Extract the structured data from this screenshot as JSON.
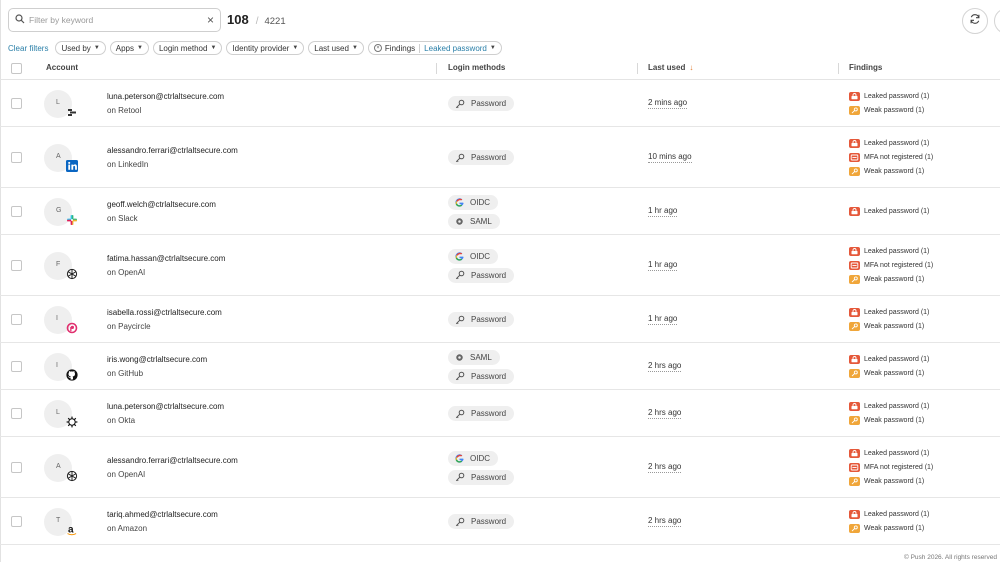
{
  "search": {
    "placeholder": "Filter by keyword",
    "value": ""
  },
  "count": {
    "shown": "108",
    "separator": "/",
    "total": "4221"
  },
  "filters": {
    "clear_label": "Clear filters",
    "chips": [
      {
        "label": "Used by",
        "value": ""
      },
      {
        "label": "Apps",
        "value": ""
      },
      {
        "label": "Login method",
        "value": ""
      },
      {
        "label": "Identity provider",
        "value": ""
      },
      {
        "label": "Last used",
        "value": ""
      },
      {
        "label": "Findings",
        "value": "Leaked password"
      }
    ]
  },
  "columns": {
    "account": "Account",
    "login_methods": "Login methods",
    "last_used": "Last used",
    "findings": "Findings"
  },
  "sort": {
    "column": "Last used",
    "direction": "desc",
    "arrow": "↓"
  },
  "colors": {
    "accent": "#2a7fa8",
    "leaked": "#e5583a",
    "weak": "#f0a63a",
    "sort_arrow": "#e07a2e"
  },
  "rows": [
    {
      "initial": "L",
      "app_icon": "retool-icon",
      "email": "luna.peterson@ctrlaltsecure.com",
      "app": "on Retool",
      "methods": [
        {
          "icon": "key-icon",
          "label": "Password"
        }
      ],
      "last_used": "2 mins ago",
      "findings": [
        {
          "type": "leaked",
          "label": "Leaked password (1)"
        },
        {
          "type": "weak",
          "label": "Weak password (1)"
        }
      ]
    },
    {
      "initial": "A",
      "app_icon": "linkedin-icon",
      "email": "alessandro.ferrari@ctrlaltsecure.com",
      "app": "on LinkedIn",
      "methods": [
        {
          "icon": "key-icon",
          "label": "Password"
        }
      ],
      "last_used": "10 mins ago",
      "findings": [
        {
          "type": "leaked",
          "label": "Leaked password (1)"
        },
        {
          "type": "mfa",
          "label": "MFA not registered (1)"
        },
        {
          "type": "weak",
          "label": "Weak password (1)"
        }
      ]
    },
    {
      "initial": "G",
      "app_icon": "slack-icon",
      "email": "geoff.welch@ctrlaltsecure.com",
      "app": "on Slack",
      "methods": [
        {
          "icon": "google-icon",
          "label": "OIDC"
        },
        {
          "icon": "saml-icon",
          "label": "SAML"
        }
      ],
      "last_used": "1 hr ago",
      "findings": [
        {
          "type": "leaked",
          "label": "Leaked password (1)"
        }
      ]
    },
    {
      "initial": "F",
      "app_icon": "openai-icon",
      "email": "fatima.hassan@ctrlaltsecure.com",
      "app": "on OpenAI",
      "methods": [
        {
          "icon": "google-icon",
          "label": "OIDC"
        },
        {
          "icon": "key-icon",
          "label": "Password"
        }
      ],
      "last_used": "1 hr ago",
      "findings": [
        {
          "type": "leaked",
          "label": "Leaked password (1)"
        },
        {
          "type": "mfa",
          "label": "MFA not registered (1)"
        },
        {
          "type": "weak",
          "label": "Weak password (1)"
        }
      ]
    },
    {
      "initial": "I",
      "app_icon": "paycircle-icon",
      "email": "isabella.rossi@ctrlaltsecure.com",
      "app": "on Paycircle",
      "methods": [
        {
          "icon": "key-icon",
          "label": "Password"
        }
      ],
      "last_used": "1 hr ago",
      "findings": [
        {
          "type": "leaked",
          "label": "Leaked password (1)"
        },
        {
          "type": "weak",
          "label": "Weak password (1)"
        }
      ]
    },
    {
      "initial": "I",
      "app_icon": "github-icon",
      "email": "iris.wong@ctrlaltsecure.com",
      "app": "on GitHub",
      "methods": [
        {
          "icon": "saml-icon",
          "label": "SAML"
        },
        {
          "icon": "key-icon",
          "label": "Password"
        }
      ],
      "last_used": "2 hrs ago",
      "findings": [
        {
          "type": "leaked",
          "label": "Leaked password (1)"
        },
        {
          "type": "weak",
          "label": "Weak password (1)"
        }
      ]
    },
    {
      "initial": "L",
      "app_icon": "okta-icon",
      "email": "luna.peterson@ctrlaltsecure.com",
      "app": "on Okta",
      "methods": [
        {
          "icon": "key-icon",
          "label": "Password"
        }
      ],
      "last_used": "2 hrs ago",
      "findings": [
        {
          "type": "leaked",
          "label": "Leaked password (1)"
        },
        {
          "type": "weak",
          "label": "Weak password (1)"
        }
      ]
    },
    {
      "initial": "A",
      "app_icon": "openai-icon",
      "email": "alessandro.ferrari@ctrlaltsecure.com",
      "app": "on OpenAI",
      "methods": [
        {
          "icon": "google-icon",
          "label": "OIDC"
        },
        {
          "icon": "key-icon",
          "label": "Password"
        }
      ],
      "last_used": "2 hrs ago",
      "findings": [
        {
          "type": "leaked",
          "label": "Leaked password (1)"
        },
        {
          "type": "mfa",
          "label": "MFA not registered (1)"
        },
        {
          "type": "weak",
          "label": "Weak password (1)"
        }
      ]
    },
    {
      "initial": "T",
      "app_icon": "amazon-icon",
      "email": "tariq.ahmed@ctrlaltsecure.com",
      "app": "on Amazon",
      "methods": [
        {
          "icon": "key-icon",
          "label": "Password"
        }
      ],
      "last_used": "2 hrs ago",
      "findings": [
        {
          "type": "leaked",
          "label": "Leaked password (1)"
        },
        {
          "type": "weak",
          "label": "Weak password (1)"
        }
      ]
    }
  ],
  "footer": "© Push 2026. All rights reserved"
}
